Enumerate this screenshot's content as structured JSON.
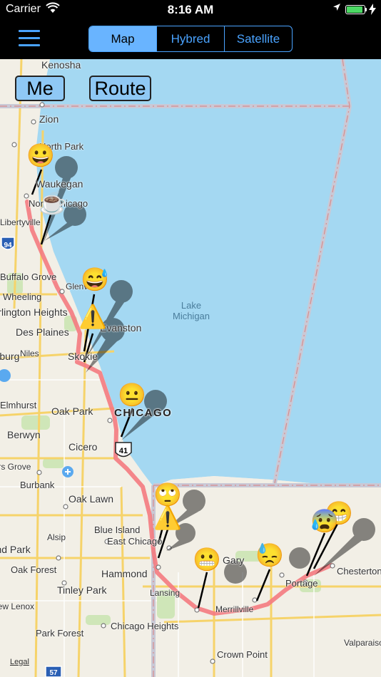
{
  "status_bar": {
    "carrier": "Carrier",
    "wifi_icon": "wifi-icon",
    "time": "8:16 AM",
    "location_icon": "location-arrow-icon",
    "battery_level": 1.0,
    "charging_icon": "bolt-icon"
  },
  "navbar": {
    "menu_icon": "hamburger-menu-icon",
    "segments": [
      {
        "label": "Map",
        "selected": true
      },
      {
        "label": "Hybred",
        "selected": false
      },
      {
        "label": "Satellite",
        "selected": false
      }
    ]
  },
  "map_buttons": {
    "me": "Me",
    "route": "Route"
  },
  "map": {
    "labels": {
      "kenosha": "Kenosha",
      "zion": "Zion",
      "north_park": "North Park",
      "waukegan": "Waukegan",
      "north_chicago": "North Chicago",
      "libertyville": "Libertyville",
      "buffalo_grove": "Buffalo Grove",
      "wheeling": "Wheeling",
      "glenview": "Glenview",
      "arlington_heights": "Arlington Heights",
      "des_plaines": "Des Plaines",
      "evanston": "Evanston",
      "niles": "Niles",
      "skokie": "Skokie",
      "schaumburg": "Schaumburg",
      "elmhurst": "Elmhurst",
      "oak_park": "Oak Park",
      "chicago": "CHICAGO",
      "berwyn": "Berwyn",
      "cicero": "Cicero",
      "rs_grove": "Downers Grove",
      "burbank": "Burbank",
      "oak_lawn": "Oak Lawn",
      "blue_island": "Blue Island",
      "east_chicago": "East Chicago",
      "alsip": "Alsip",
      "orland_park": "Orland Park",
      "gary": "Gary",
      "oak_forest": "Oak Forest",
      "hammond": "Hammond",
      "chesterton": "Chesterton",
      "portage": "Portage",
      "tinley_park": "Tinley Park",
      "lansing": "Lansing",
      "merrillville": "Merrillville",
      "new_lenox": "New Lenox",
      "chicago_heights": "Chicago Heights",
      "valparaiso": "Valparaiso",
      "park_forest": "Park Forest",
      "crown_point": "Crown Point",
      "lake_michigan_line1": "Lake",
      "lake_michigan_line2": "Michigan",
      "legal": "Legal"
    },
    "shields": {
      "i94": "94",
      "us41": "41",
      "i57": "57"
    },
    "colors": {
      "water": "#a4d8f2",
      "land": "#f2efe6",
      "route": "#f47a80",
      "accent": "#4aa3ff"
    }
  },
  "pins": [
    {
      "icon": "grinning-face-icon",
      "glyph": "😀"
    },
    {
      "icon": "coffee-cup-icon",
      "glyph": "☕"
    },
    {
      "icon": "sweat-smile-face-icon",
      "glyph": "😅"
    },
    {
      "icon": "warning-sign-icon",
      "glyph": "⚠️"
    },
    {
      "icon": "neutral-face-icon",
      "glyph": "😐"
    },
    {
      "icon": "eye-roll-face-icon",
      "glyph": "🙄"
    },
    {
      "icon": "warning-sign-icon",
      "glyph": "⚠️"
    },
    {
      "icon": "grimacing-face-icon",
      "glyph": "😬"
    },
    {
      "icon": "downcast-sweat-face-icon",
      "glyph": "😓"
    },
    {
      "icon": "anxious-sweat-face-icon",
      "glyph": "😰"
    },
    {
      "icon": "grinning-face-icon",
      "glyph": "😁"
    }
  ]
}
